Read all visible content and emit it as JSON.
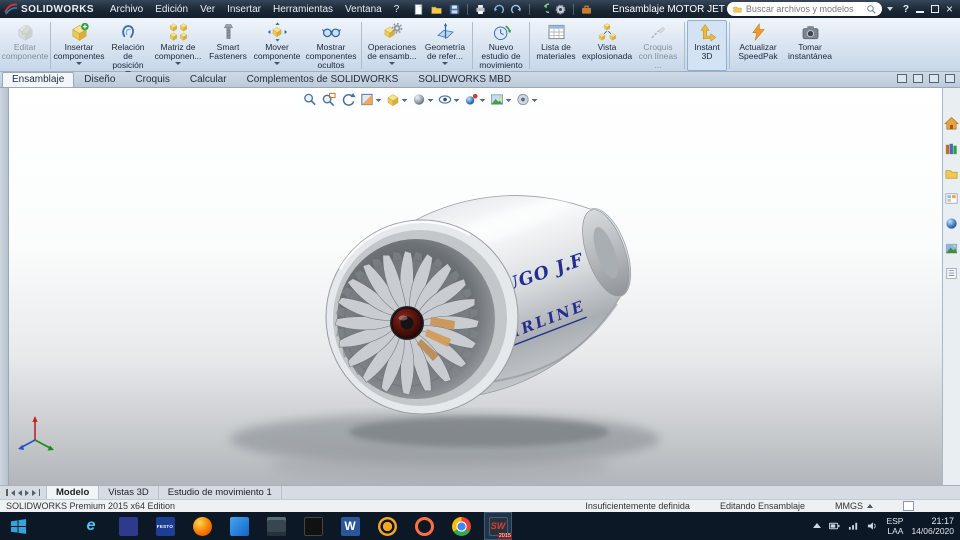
{
  "colors": {
    "titlebar_bg": "#1b2835",
    "taskbar_bg": "#0c1826",
    "decal_blue": "#252e8e",
    "ribbon_bg": "#d6e2ef",
    "accent_orange": "#f59a23"
  },
  "titlebar": {
    "logo_text": "SOLIDWORKS",
    "menus": [
      "Archivo",
      "Edición",
      "Ver",
      "Insertar",
      "Herramientas",
      "Ventana",
      "?"
    ],
    "toolbar_icons": [
      "new-icon",
      "open-icon",
      "save-icon",
      "print-icon",
      "undo-icon",
      "redo-icon",
      "rebuild-icon",
      "options-icon",
      "toolbox-icon"
    ],
    "document_title": "Ensamblaje MOTOR JET",
    "search_placeholder": "Buscar archivos y modelos",
    "window_controls": [
      "help",
      "minimize",
      "maximize",
      "close"
    ]
  },
  "ribbon": {
    "buttons": [
      {
        "label": "Editar componente",
        "icon": "edit-component-icon",
        "disabled": true,
        "dropdown": false
      },
      {
        "label": "Insertar componentes",
        "icon": "insert-components-icon",
        "disabled": false,
        "dropdown": true
      },
      {
        "label": "Relación de posición",
        "icon": "mate-icon",
        "disabled": false,
        "dropdown": true
      },
      {
        "label": "Matriz de componen...",
        "icon": "component-pattern-icon",
        "disabled": false,
        "dropdown": true
      },
      {
        "label": "Smart Fasteners",
        "icon": "smart-fasteners-icon",
        "disabled": false,
        "dropdown": false
      },
      {
        "label": "Mover componente",
        "icon": "move-component-icon",
        "disabled": false,
        "dropdown": true
      },
      {
        "label": "Mostrar componentes ocultos",
        "icon": "show-hidden-components-icon",
        "disabled": false,
        "dropdown": false
      },
      {
        "label": "Operaciones de ensamb...",
        "icon": "assembly-features-icon",
        "disabled": false,
        "dropdown": true
      },
      {
        "label": "Geometría de refer...",
        "icon": "reference-geometry-icon",
        "disabled": false,
        "dropdown": true
      },
      {
        "label": "Nuevo estudio de movimiento",
        "icon": "motion-study-icon",
        "disabled": false,
        "dropdown": false
      },
      {
        "label": "Lista de materiales",
        "icon": "bom-icon",
        "disabled": false,
        "dropdown": false
      },
      {
        "label": "Vista explosionada",
        "icon": "exploded-view-icon",
        "disabled": false,
        "dropdown": false
      },
      {
        "label": "Croquis con líneas ...",
        "icon": "explode-line-sketch-icon",
        "disabled": true,
        "dropdown": false
      },
      {
        "label": "Instant 3D",
        "icon": "instant3d-icon",
        "disabled": false,
        "dropdown": false,
        "active": true
      },
      {
        "label": "Actualizar SpeedPak",
        "icon": "speedpak-icon",
        "disabled": false,
        "dropdown": false
      },
      {
        "label": "Tomar instantánea",
        "icon": "snapshot-icon",
        "disabled": false,
        "dropdown": false
      }
    ]
  },
  "command_tabs": {
    "items": [
      "Ensamblaje",
      "Diseño",
      "Croquis",
      "Calcular",
      "Complementos de SOLIDWORKS",
      "SOLIDWORKS MBD"
    ],
    "active_index": 0
  },
  "viewport": {
    "heads_up_icons": [
      "zoom-fit-icon",
      "zoom-area-icon",
      "previous-view-icon",
      "section-view-icon",
      "view-orientation-icon",
      "display-style-icon",
      "hide-show-items-icon",
      "edit-appearance-icon",
      "apply-scene-icon",
      "view-settings-icon"
    ],
    "model_text_top": "HUGO J.F",
    "model_text_bottom": "AIRLINE",
    "task_pane_icons": [
      "home-icon",
      "design-library-icon",
      "file-explorer-icon",
      "view-palette-icon",
      "appearances-icon",
      "scenes-icon",
      "custom-properties-icon"
    ]
  },
  "document_tabs": {
    "items": [
      "Modelo",
      "Vistas 3D",
      "Estudio de movimiento 1"
    ],
    "active_index": 0
  },
  "statusbar": {
    "edition": "SOLIDWORKS Premium 2015 x64 Edition",
    "definition_status": "Insuficientemente definida",
    "mode": "Editando Ensamblaje",
    "units": "MMGS"
  },
  "taskbar": {
    "apps": [
      {
        "name": "edge",
        "glyph": "e"
      },
      {
        "name": "app-indigo",
        "glyph": ""
      },
      {
        "name": "festo",
        "glyph": "FESTO"
      },
      {
        "name": "firefox",
        "glyph": ""
      },
      {
        "name": "app-blue",
        "glyph": ""
      },
      {
        "name": "file-manager",
        "glyph": ""
      },
      {
        "name": "console",
        "glyph": ""
      },
      {
        "name": "word",
        "glyph": "W"
      },
      {
        "name": "settings",
        "glyph": ""
      },
      {
        "name": "media",
        "glyph": ""
      },
      {
        "name": "chrome",
        "glyph": ""
      },
      {
        "name": "solidworks",
        "glyph": "SW",
        "badge": "2015",
        "active": true
      }
    ],
    "tray": {
      "lang_primary": "ESP",
      "lang_secondary": "LAA",
      "time": "21:17",
      "date": "14/06/2020"
    }
  }
}
